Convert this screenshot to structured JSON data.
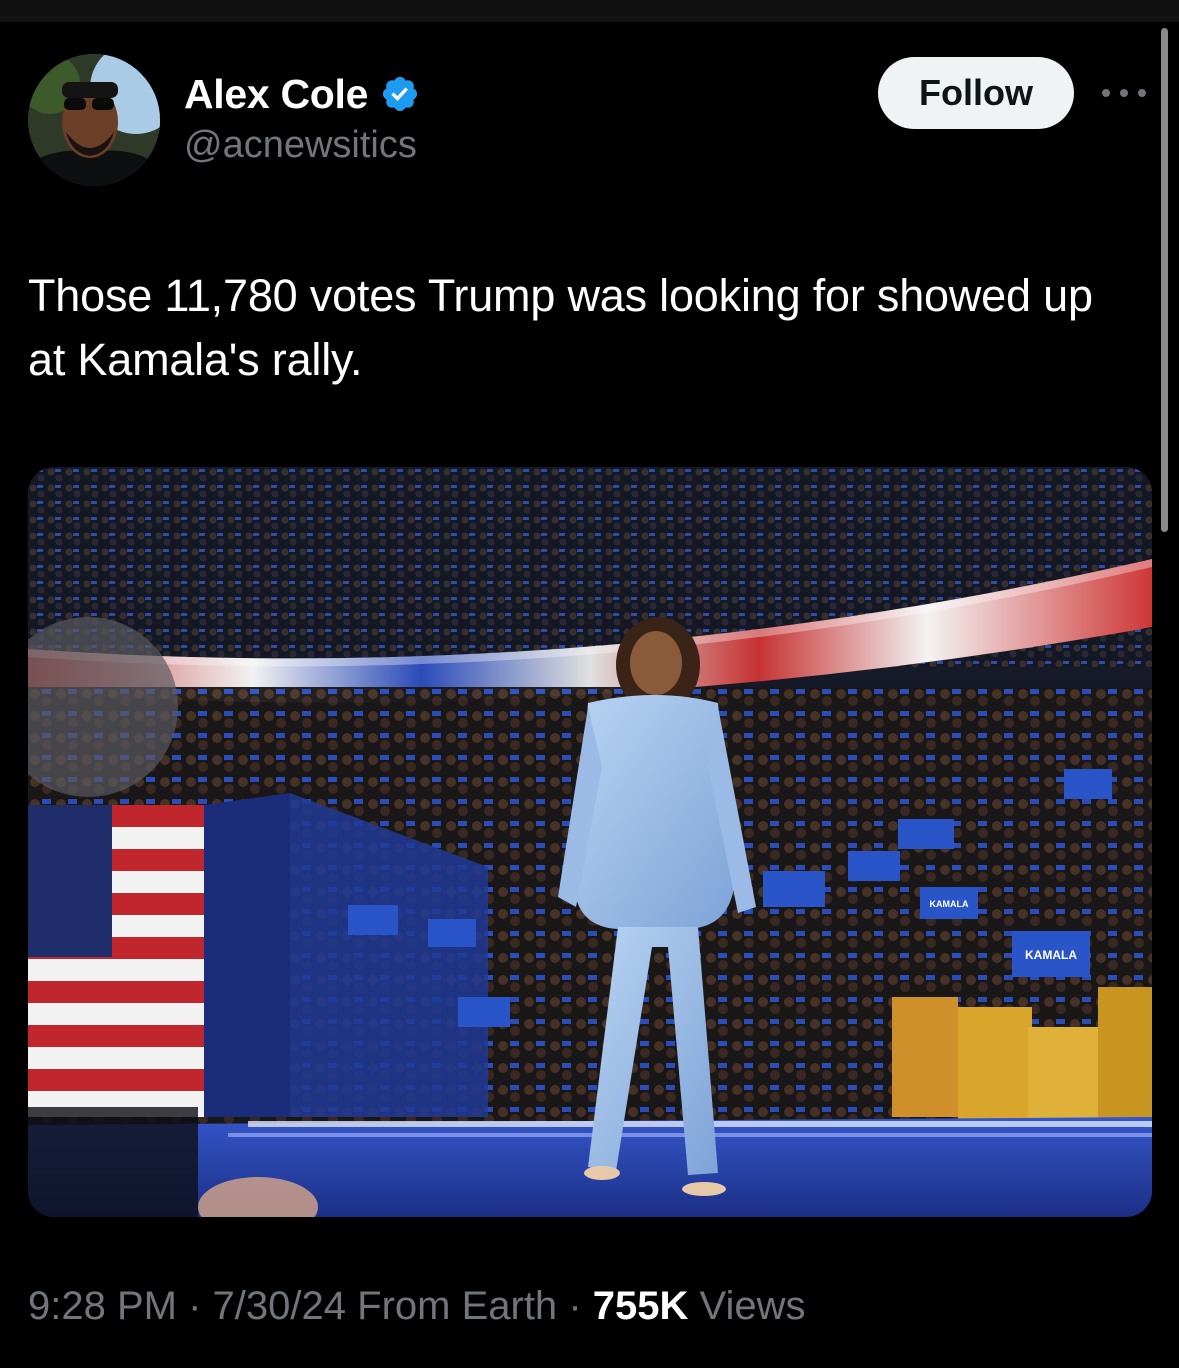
{
  "tweet": {
    "author": {
      "name": "Alex Cole",
      "handle": "@acnewsitics",
      "verified": true
    },
    "follow_label": "Follow",
    "text": "Those 11,780 votes Trump was looking for showed up at Kamala's rally.",
    "meta": {
      "time": "9:28 PM",
      "date": "7/30/24",
      "location": "From Earth",
      "views_count": "755K",
      "views_label": "Views",
      "separator": "·"
    }
  },
  "media": {
    "type": "photo",
    "sign_text": "KAMALA"
  },
  "colors": {
    "background": "#000000",
    "text_primary": "#ffffff",
    "text_secondary": "#71767b",
    "verified_blue": "#1d9bf0",
    "follow_bg": "#eff3f4"
  }
}
